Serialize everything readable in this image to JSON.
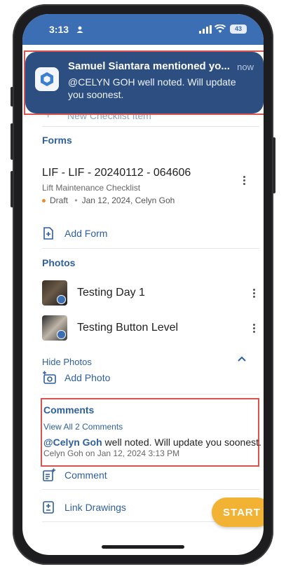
{
  "status_bar": {
    "time": "3:13",
    "battery": "43"
  },
  "notification": {
    "title": "Samuel Siantara mentioned yo...",
    "time": "now",
    "body": "@CELYN GOH well noted. Will update you soonest."
  },
  "checklist": {
    "new_item_label": "New Checklist Item"
  },
  "forms": {
    "section_title": "Forms",
    "items": [
      {
        "title": "LIF - LIF - 20240112 - 064606",
        "subtitle": "Lift Maintenance Checklist",
        "status": "Draft",
        "meta": "Jan 12, 2024, Celyn Goh"
      }
    ],
    "add_label": "Add Form"
  },
  "photos": {
    "section_title": "Photos",
    "items": [
      {
        "label": "Testing Day 1"
      },
      {
        "label": "Testing Button Level"
      }
    ],
    "hide_label": "Hide Photos",
    "add_label": "Add Photo"
  },
  "comments": {
    "section_title": "Comments",
    "view_all": "View All 2 Comments",
    "latest": {
      "mention": "@Celyn Goh",
      "text": " well noted. Will update you soonest.",
      "meta": "Celyn Goh on Jan 12, 2024 3:13 PM"
    },
    "add_label": "Comment"
  },
  "drawings": {
    "link_label": "Link Drawings"
  },
  "start_button": "START",
  "colors": {
    "accent": "#2e5f9e",
    "status_bar": "#3b6eb3",
    "notification_bg": "#2d4e80",
    "start": "#f2b233",
    "draft": "#f08a24",
    "highlight": "#d9534f"
  }
}
